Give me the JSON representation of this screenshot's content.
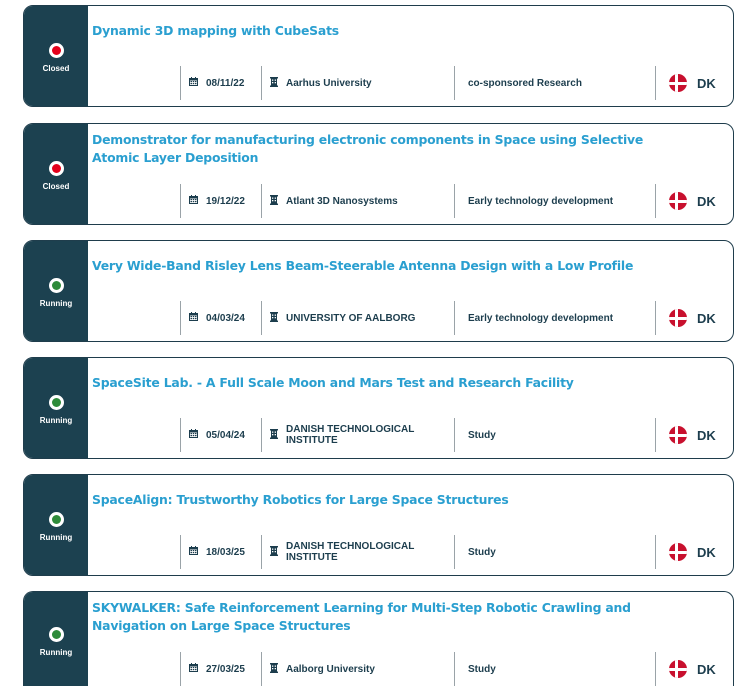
{
  "colors": {
    "panel": "#1c4150",
    "title": "#2a9fd0",
    "closed_dot": "#e3001b",
    "running_dot": "#2e8b3a",
    "flag_red": "#c8102e"
  },
  "icons": {
    "date": "calendar-icon",
    "org": "building-icon",
    "country": "denmark-flag-icon"
  },
  "projects": [
    {
      "status": "Closed",
      "title": "Dynamic 3D mapping with CubeSats",
      "date": "08/11/22",
      "organisation": "Aarhus University",
      "type": "co-sponsored Research",
      "country": "DK"
    },
    {
      "status": "Closed",
      "title": "Demonstrator for manufacturing electronic components in Space using Selective Atomic Layer Deposition",
      "date": "19/12/22",
      "organisation": "Atlant 3D Nanosystems",
      "type": "Early technology development",
      "country": "DK"
    },
    {
      "status": "Running",
      "title": "Very Wide-Band Risley Lens Beam-Steerable Antenna Design with a Low Profile",
      "date": "04/03/24",
      "organisation": "UNIVERSITY OF AALBORG",
      "type": "Early technology development",
      "country": "DK"
    },
    {
      "status": "Running",
      "title": "SpaceSite Lab. - A Full Scale Moon and Mars Test and Research Facility",
      "date": "05/04/24",
      "organisation": "DANISH TECHNOLOGICAL INSTITUTE",
      "type": "Study",
      "country": "DK"
    },
    {
      "status": "Running",
      "title": "SpaceAlign: Trustworthy Robotics for Large Space Structures",
      "date": "18/03/25",
      "organisation": "DANISH TECHNOLOGICAL INSTITUTE",
      "type": "Study",
      "country": "DK"
    },
    {
      "status": "Running",
      "title": "SKYWALKER: Safe Reinforcement Learning for Multi-Step Robotic Crawling and Navigation on Large Space Structures",
      "date": "27/03/25",
      "organisation": "Aalborg University",
      "type": "Study",
      "country": "DK"
    }
  ]
}
